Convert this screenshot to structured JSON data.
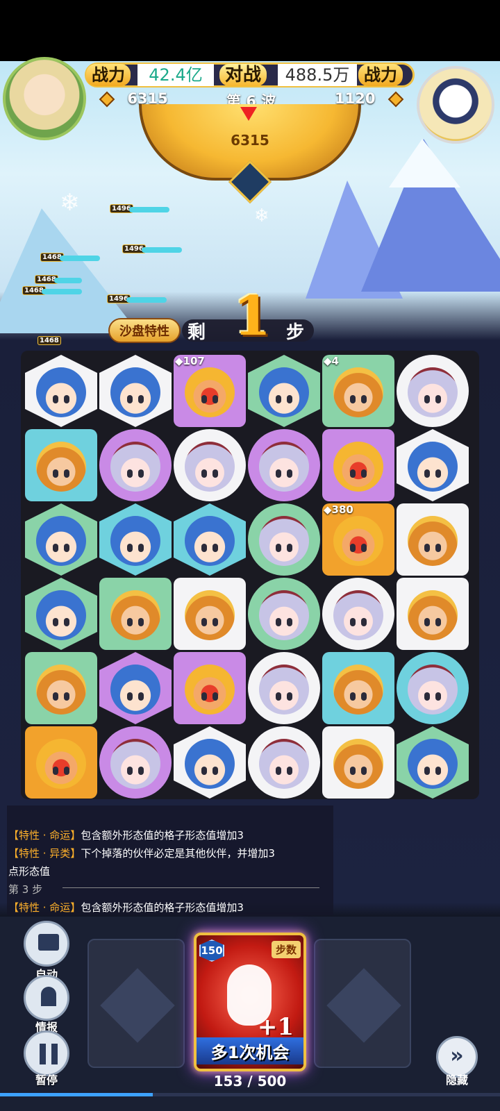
{
  "header": {
    "left_power_label": "战力",
    "left_power_value": "42.4亿",
    "vs_label": "对战",
    "right_power_value": "488.5万",
    "right_power_label": "战力",
    "left_score": "6315",
    "wave_label": "第 6 波",
    "right_score": "1120",
    "dial_value": "6315"
  },
  "battle": {
    "enemy_hp_labels": [
      "1496",
      "1496",
      "1468",
      "1468",
      "1468",
      "1496",
      "1468"
    ]
  },
  "steps_banner": {
    "trait_label": "沙盘特性",
    "left_text": "剩",
    "steps_value": "1",
    "right_text": "步"
  },
  "board": {
    "rows": [
      [
        {
          "face": "blue",
          "tile": "white",
          "shape": "hex"
        },
        {
          "face": "blue",
          "tile": "white",
          "shape": "hex"
        },
        {
          "face": "redmask",
          "tile": "purple",
          "shape": "square",
          "badge": "107"
        },
        {
          "face": "blue",
          "tile": "green",
          "shape": "hex"
        },
        {
          "face": "monkey",
          "tile": "green",
          "shape": "square",
          "badge": "4"
        },
        {
          "face": "bunny",
          "tile": "white",
          "shape": "circle"
        }
      ],
      [
        {
          "face": "monkey",
          "tile": "teal",
          "shape": "square"
        },
        {
          "face": "bunny",
          "tile": "purple",
          "shape": "circle"
        },
        {
          "face": "bunny",
          "tile": "white",
          "shape": "circle"
        },
        {
          "face": "bunny",
          "tile": "purple",
          "shape": "circle"
        },
        {
          "face": "redmask",
          "tile": "purple",
          "shape": "square"
        },
        {
          "face": "blue",
          "tile": "white",
          "shape": "hex"
        }
      ],
      [
        {
          "face": "blue",
          "tile": "green",
          "shape": "hex"
        },
        {
          "face": "blue",
          "tile": "teal",
          "shape": "hex"
        },
        {
          "face": "blue",
          "tile": "teal",
          "shape": "hex"
        },
        {
          "face": "bunny",
          "tile": "green",
          "shape": "circle"
        },
        {
          "face": "redmask",
          "tile": "orange",
          "shape": "square",
          "badge": "380"
        },
        {
          "face": "monkey",
          "tile": "white",
          "shape": "square"
        }
      ],
      [
        {
          "face": "blue",
          "tile": "green",
          "shape": "hex"
        },
        {
          "face": "monkey",
          "tile": "green",
          "shape": "square"
        },
        {
          "face": "monkey",
          "tile": "white",
          "shape": "square"
        },
        {
          "face": "bunny",
          "tile": "green",
          "shape": "circle"
        },
        {
          "face": "bunny",
          "tile": "white",
          "shape": "circle"
        },
        {
          "face": "monkey",
          "tile": "white",
          "shape": "square"
        }
      ],
      [
        {
          "face": "monkey",
          "tile": "green",
          "shape": "square"
        },
        {
          "face": "blue",
          "tile": "purple",
          "shape": "hex"
        },
        {
          "face": "redmask",
          "tile": "purple",
          "shape": "square"
        },
        {
          "face": "bunny",
          "tile": "white",
          "shape": "circle"
        },
        {
          "face": "monkey",
          "tile": "teal",
          "shape": "square"
        },
        {
          "face": "bunny",
          "tile": "teal",
          "shape": "circle"
        }
      ],
      [
        {
          "face": "redmask",
          "tile": "orange",
          "shape": "square"
        },
        {
          "face": "bunny",
          "tile": "purple",
          "shape": "circle"
        },
        {
          "face": "blue",
          "tile": "white",
          "shape": "hex"
        },
        {
          "face": "bunny",
          "tile": "white",
          "shape": "circle"
        },
        {
          "face": "monkey",
          "tile": "white",
          "shape": "square"
        },
        {
          "face": "blue",
          "tile": "green",
          "shape": "hex"
        }
      ]
    ]
  },
  "log": {
    "line1_tag": "【特性 · 命运】",
    "line1_text": "包含额外形态值的格子形态值增加3",
    "line2_tag": "【特性 · 异类】",
    "line2_text": "下个掉落的伙伴必定是其他伙伴，并增加3",
    "line3_text": "点形态值",
    "step_label": "第 3 步",
    "line4_tag": "【特性 · 命运】",
    "line4_text": "包含额外形态值的格子形态值增加3"
  },
  "controls": {
    "auto_label": "自动",
    "info_label": "情报",
    "pause_label": "暂停",
    "hide_label": "隐藏"
  },
  "card": {
    "level": "150",
    "tag": "步数",
    "plus": "+1",
    "name": "多1次机会"
  },
  "progress": {
    "text": "153 / 500",
    "current": 153,
    "max": 500
  },
  "colors": {
    "gold": "#f0c040",
    "progress": "#3da2ff"
  }
}
